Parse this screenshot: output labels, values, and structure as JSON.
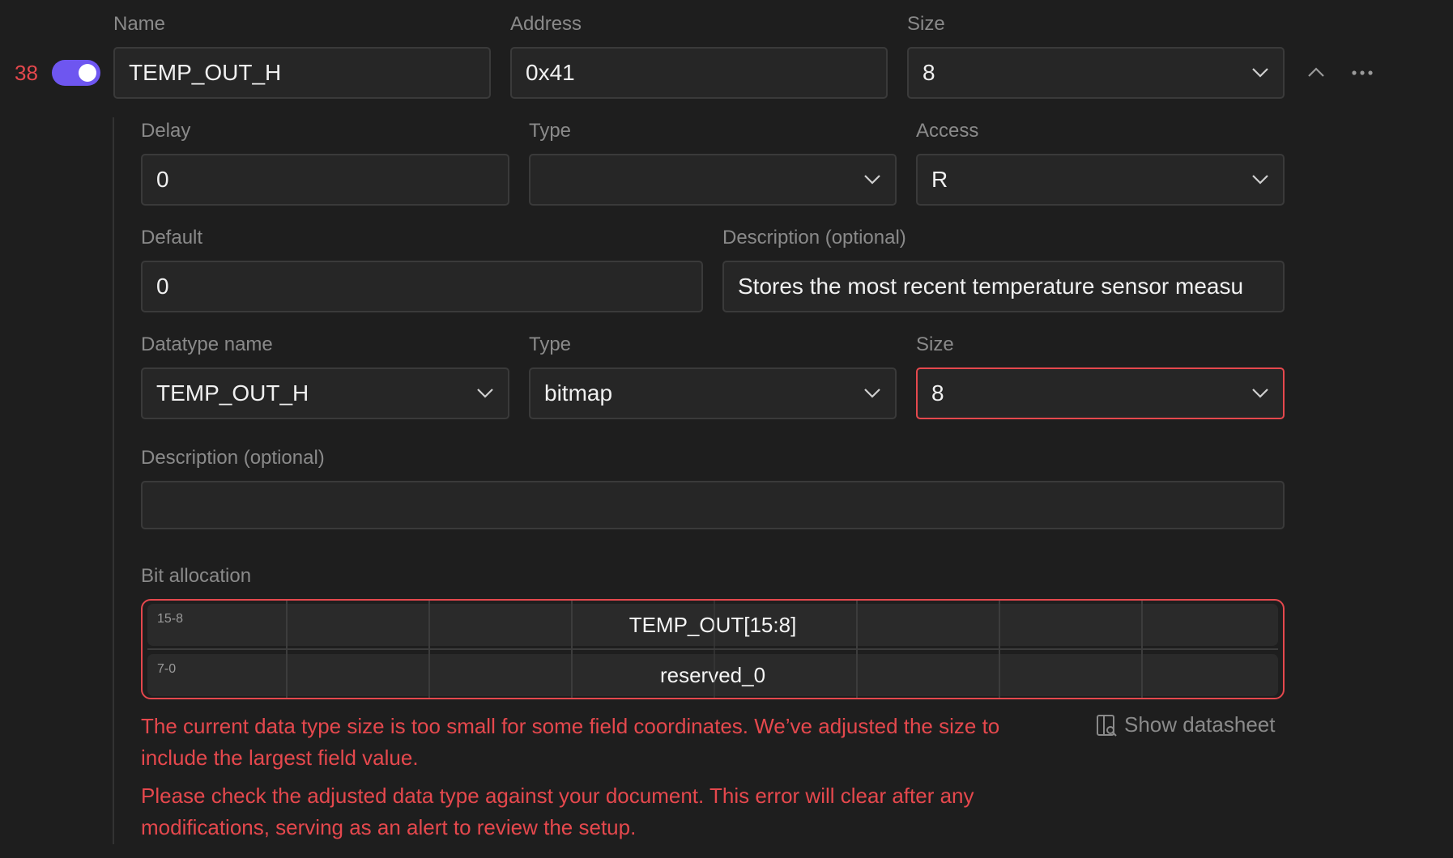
{
  "register": {
    "index": "38",
    "enabled": true,
    "name_label": "Name",
    "name_value": "TEMP_OUT_H",
    "address_label": "Address",
    "address_value": "0x41",
    "size_label": "Size",
    "size_value": "8"
  },
  "details": {
    "delay_label": "Delay",
    "delay_value": "0",
    "type_label": "Type",
    "type_value": "",
    "access_label": "Access",
    "access_value": "R",
    "default_label": "Default",
    "default_value": "0",
    "description_label": "Description (optional)",
    "description_value": "Stores the most recent temperature sensor measu"
  },
  "datatype": {
    "name_label": "Datatype name",
    "name_value": "TEMP_OUT_H",
    "type_label": "Type",
    "type_value": "bitmap",
    "size_label": "Size",
    "size_value": "8",
    "description_label": "Description (optional)",
    "description_value": ""
  },
  "bit_allocation": {
    "label": "Bit allocation",
    "rows": [
      {
        "range": "15-8",
        "field": "TEMP_OUT[15:8]"
      },
      {
        "range": "7-0",
        "field": "reserved_0"
      }
    ]
  },
  "errors": {
    "message_1": "The current data type size is too small for some field coordinates. We’ve adjusted the size to include the largest field value.",
    "message_2": "Please check the adjusted data type against your document. This error will clear after any modifications, serving as an alert to review the setup."
  },
  "show_datasheet_label": "Show datasheet",
  "colors": {
    "background": "#1e1e1e",
    "accent": "#6e56f0",
    "error": "#e5484d"
  },
  "icons": [
    "toggle-switch",
    "chevron-down-icon",
    "chevron-up-icon",
    "more-icon",
    "datasheet-icon"
  ]
}
